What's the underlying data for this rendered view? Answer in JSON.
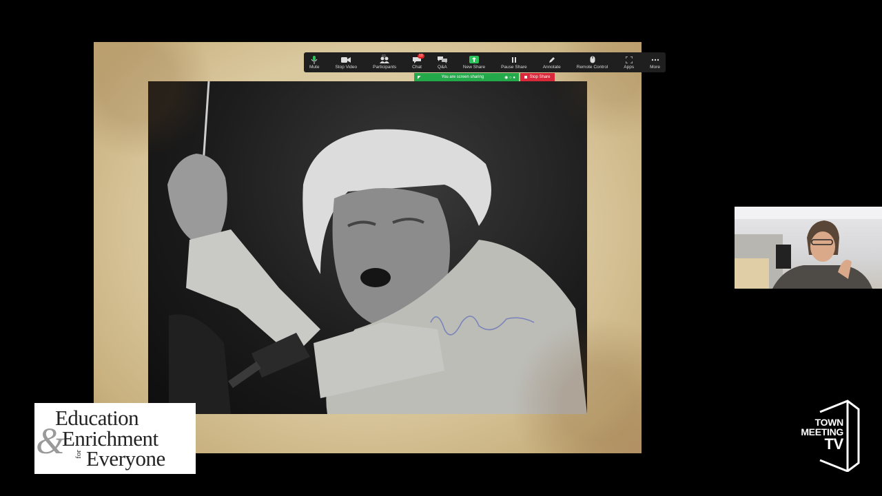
{
  "zoom_toolbar": {
    "items": [
      {
        "label": "Mute",
        "icon": "microphone-icon"
      },
      {
        "label": "Stop Video",
        "icon": "video-camera-icon"
      },
      {
        "label": "Participants",
        "icon": "participants-icon",
        "count": "60"
      },
      {
        "label": "Chat",
        "icon": "chat-icon",
        "badge": "10"
      },
      {
        "label": "Q&A",
        "icon": "qa-icon"
      },
      {
        "label": "New Share",
        "icon": "share-screen-icon"
      },
      {
        "label": "Pause Share",
        "icon": "pause-icon"
      },
      {
        "label": "Annotate",
        "icon": "pencil-icon"
      },
      {
        "label": "Remote Control",
        "icon": "mouse-icon"
      },
      {
        "label": "Apps",
        "icon": "apps-icon"
      },
      {
        "label": "More",
        "icon": "more-icon"
      }
    ],
    "sharing_status": "You are screen sharing",
    "stop_share_label": "Stop Share",
    "colors": {
      "toolbar_bg": "#1f1f1f",
      "sharing_green": "#23a84a",
      "stop_red": "#d9283a"
    }
  },
  "slide": {
    "photo_subject": "black-and-white photograph of a conductor with raised baton",
    "signature": "autograph"
  },
  "logos": {
    "eee": {
      "line1": "Education",
      "ampersand": "&",
      "line2": "Enrichment",
      "for": "for",
      "line3": "Everyone"
    },
    "tmtv": {
      "line1": "TOWN",
      "line2": "MEETING",
      "line3": "TV"
    }
  }
}
